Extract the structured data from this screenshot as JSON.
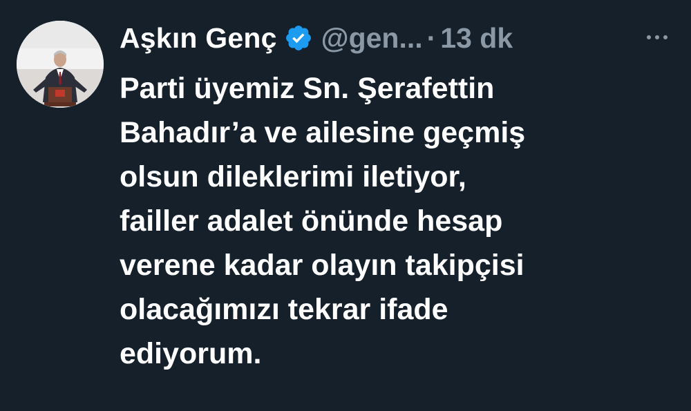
{
  "tweet": {
    "author": {
      "name": "Aşkın Genç",
      "handle": "@gen...",
      "verified": true,
      "avatar_icon": "person-at-podium-avatar"
    },
    "separator": "·",
    "time": "13 dk",
    "more_icon": "more-options-icon",
    "text_lines": [
      "Parti üyemiz Sn. Şerafettin",
      "Bahadır’a ve ailesine geçmiş",
      "olsun dileklerimi iletiyor,",
      "failler adalet önünde hesap",
      "verene kadar olayın takipçisi",
      "olacağımızı tekrar ifade",
      "ediyorum."
    ]
  },
  "colors": {
    "background": "#15202b",
    "primary_text": "#ffffff",
    "secondary_text": "#8b98a5",
    "verified_badge": "#1d9bf0"
  }
}
